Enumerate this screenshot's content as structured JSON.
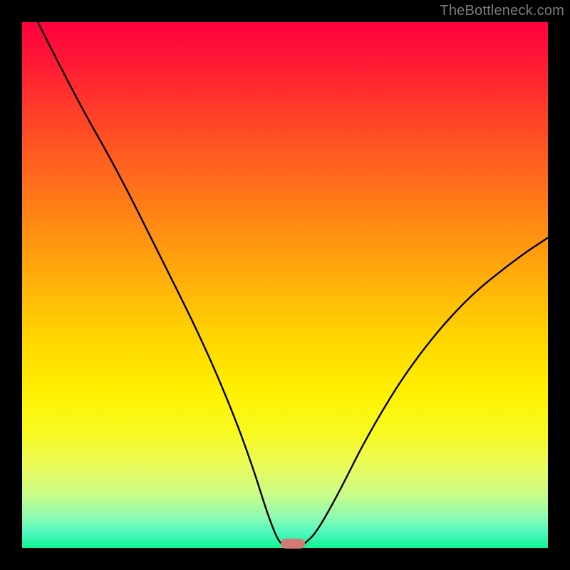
{
  "attribution": "TheBottleneck.com",
  "chart_data": {
    "type": "line",
    "title": "",
    "xlabel": "",
    "ylabel": "",
    "xlim": [
      0,
      100
    ],
    "ylim": [
      0,
      100
    ],
    "series": [
      {
        "name": "curve",
        "x": [
          3,
          10,
          18,
          26,
          34,
          40,
          44,
          46.5,
          48,
          49,
          50,
          53,
          54,
          56,
          60,
          66,
          74,
          84,
          94,
          100
        ],
        "y": [
          100,
          86,
          72,
          56,
          40,
          26,
          15,
          7,
          3,
          1,
          0.5,
          0.5,
          1,
          3,
          10,
          22,
          35,
          47,
          55,
          59
        ]
      }
    ],
    "marker": {
      "cx": 51.5,
      "cy": 0.8,
      "w": 4.6,
      "h": 1.9
    },
    "background_gradient": {
      "direction": "vertical",
      "stops": [
        {
          "pos": 0,
          "color": "#ff0040"
        },
        {
          "pos": 50,
          "color": "#ffba08"
        },
        {
          "pos": 70,
          "color": "#fff000"
        },
        {
          "pos": 100,
          "color": "#10f390"
        }
      ]
    }
  }
}
